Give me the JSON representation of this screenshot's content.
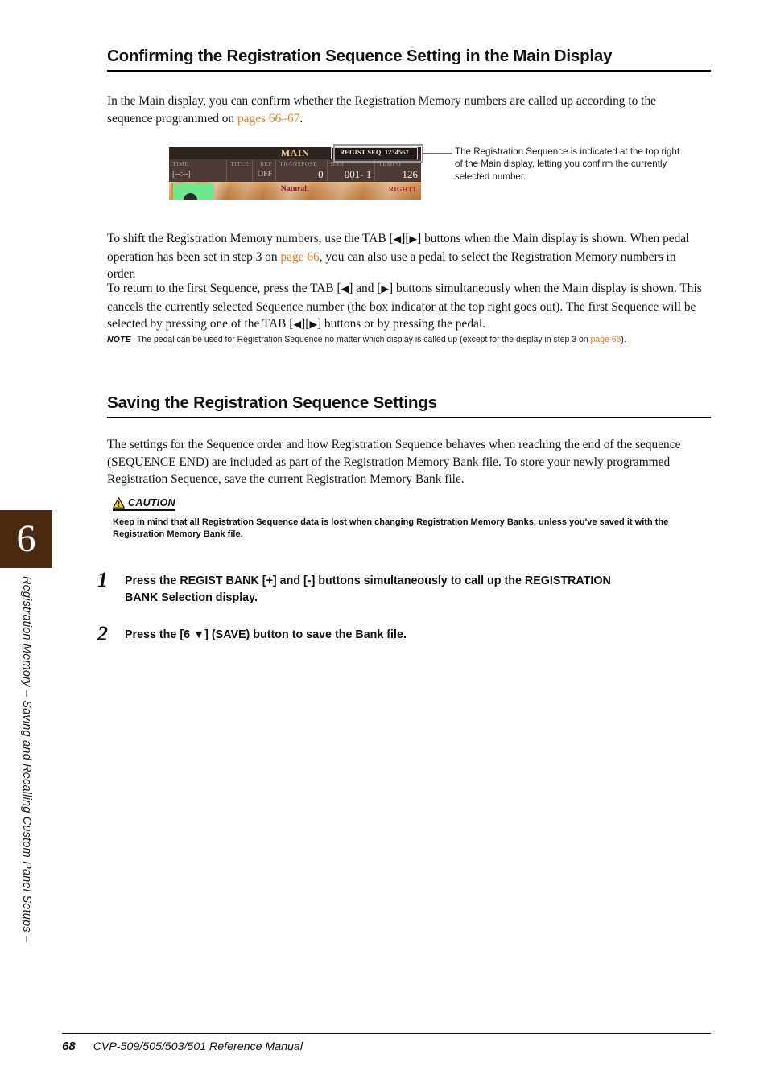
{
  "sidebar": {
    "chapter_number": "6",
    "chapter_title": "Registration Memory – Saving and Recalling Custom Panel Setups –"
  },
  "section_1": {
    "heading": "Confirming the Registration Sequence Setting in the Main Display",
    "intro_part1": "In the Main display, you can confirm whether the Registration Memory numbers are called up according to the sequence programmed on ",
    "intro_link": "pages 66–67",
    "intro_part2": ".",
    "para_shift_1": "To shift the Registration Memory numbers, use the TAB [",
    "para_shift_glyph_left": "◀",
    "para_shift_mid": "][",
    "para_shift_glyph_right": "▶",
    "para_shift_2": "] buttons when the Main display is shown. When pedal operation has been set in step 3 on ",
    "para_shift_link": "page 66",
    "para_shift_3": ", you can also use a pedal to select the Registration Memory numbers in order.",
    "para_return_1": "To return to the first Sequence, press the TAB [",
    "para_return_2": "] and [",
    "para_return_3": "] buttons simultaneously when the Main display is shown. This cancels the currently selected Sequence number (the box indicator at the top right goes out). The first Sequence will be selected by pressing one of the TAB [",
    "para_return_4": "][",
    "para_return_5": "] buttons or by pressing the pedal.",
    "note_label": "NOTE",
    "note_text_1": "The pedal can be used for Registration Sequence no matter which display is called up (except for the display in step 3 on ",
    "note_link": "page 66",
    "note_text_2": ")."
  },
  "figure": {
    "lcd": {
      "main_label": "MAIN",
      "regist_seq": "REGIST SEQ. 1234567",
      "cells": [
        {
          "label": "TIME",
          "value": "[--:--]",
          "value_small": true,
          "align": "left"
        },
        {
          "label": "TITLE",
          "value": "",
          "value_small": false,
          "align": "left"
        },
        {
          "label": "REP",
          "value": "OFF",
          "value_small": true,
          "align": "right"
        },
        {
          "label": "TRANSPOSE",
          "value": "0",
          "value_small": false,
          "align": "right"
        },
        {
          "label": "BAR",
          "value": "001- 1",
          "value_small": false,
          "align": "right"
        },
        {
          "label": "TEMPO",
          "value": "126",
          "value_small": false,
          "align": "right"
        }
      ],
      "voice_name": "Natural!",
      "part_name": "RIGHT1"
    },
    "callout": "The Registration Sequence is indicated at the top right of the Main display, letting you confirm the currently selected number."
  },
  "section_2": {
    "heading": "Saving the Registration Sequence Settings",
    "para": "The settings for the Sequence order and how Registration Sequence behaves when reaching the end of the sequence (SEQUENCE END) are included as part of the Registration Memory Bank file. To store your newly programmed Registration Sequence, save the current Registration Memory Bank file.",
    "caution_label": "CAUTION",
    "caution_text": "Keep in mind that all Registration Sequence data is lost when changing Registration Memory Banks, unless you've saved it with the Registration Memory Bank file.",
    "steps": [
      {
        "number": "1",
        "text": "Press the REGIST BANK [+] and [-] buttons simultaneously to call up the REGISTRATION BANK Selection display."
      },
      {
        "number": "2",
        "text": "Press the [6 ▼] (SAVE) button to save the Bank file."
      }
    ]
  },
  "footer": {
    "page_number": "68",
    "manual_title": "CVP-509/505/503/501 Reference Manual"
  },
  "colors": {
    "link": "#ED7D2B",
    "sidebar_tab": "#4A2A10",
    "caution_triangle": "#F5D21E"
  }
}
